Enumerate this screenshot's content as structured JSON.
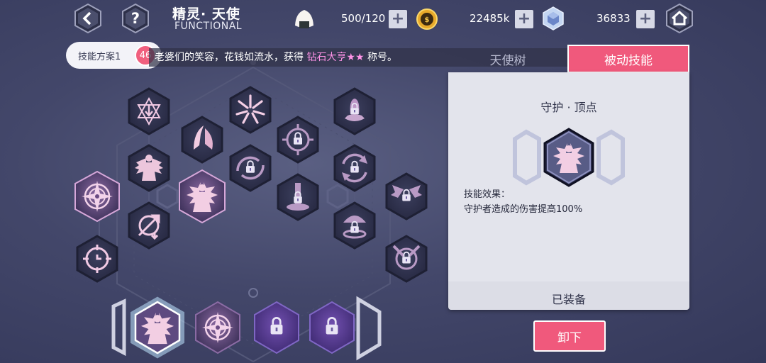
{
  "topbar": {
    "back_icon": "chevron-left-icon",
    "help_icon": "question-icon",
    "title_cn": "精灵· 天使",
    "title_en": "FUNCTIONAL",
    "stamina": "500/120",
    "coins": "22485k",
    "crystals": "36833",
    "home_icon": "home-icon"
  },
  "plan": {
    "label": "技能方案1",
    "badge": "46"
  },
  "marquee": {
    "prefix": "老婆们的笑容，花钱如流水，获得 ",
    "highlight": "钻石大亨★★",
    "suffix": " 称号。"
  },
  "tabs": {
    "tree": "天使树",
    "active": "被动技能"
  },
  "detail": {
    "skill_name": "守护 · 顶点",
    "effect_label": "技能效果：",
    "effect_text": "守护者造成的伤害提高100%",
    "status": "已装备",
    "unequip_button": "卸下"
  },
  "colors": {
    "accent": "#f0597c",
    "panel": "#e3e4ec",
    "hex_dark": "#2c2f48",
    "hex_glow": "#d98fc0"
  },
  "tree_nodes": [
    {
      "icon": "star-arrow-icon",
      "state": "unlocked"
    },
    {
      "icon": "shatter-icon",
      "state": "unlocked"
    },
    {
      "icon": "bell-lock-icon",
      "state": "locked"
    },
    {
      "icon": "wing-spirit-icon",
      "state": "unlocked"
    },
    {
      "icon": "target-lock-icon",
      "state": "locked"
    },
    {
      "icon": "winged-guardian-icon",
      "state": "unlocked"
    },
    {
      "icon": "aim-lock-icon",
      "state": "locked"
    },
    {
      "icon": "cycle-lock-icon",
      "state": "locked"
    },
    {
      "icon": "compass-icon",
      "state": "equipped"
    },
    {
      "icon": "guardian-icon",
      "state": "equipped"
    },
    {
      "icon": "pillar-lock-icon",
      "state": "locked"
    },
    {
      "icon": "angel-lock-icon",
      "state": "locked"
    },
    {
      "icon": "swirl-arrow-icon",
      "state": "unlocked"
    },
    {
      "icon": "umbrella-lock-icon",
      "state": "locked"
    },
    {
      "icon": "clock-target-icon",
      "state": "unlocked"
    },
    {
      "icon": "sword-lock-icon",
      "state": "locked"
    }
  ],
  "slots": [
    {
      "icon": "guardian-icon",
      "state": "selected"
    },
    {
      "icon": "compass-icon",
      "state": "equipped"
    },
    {
      "icon": "lock-icon",
      "state": "locked"
    },
    {
      "icon": "lock-icon",
      "state": "locked"
    }
  ]
}
